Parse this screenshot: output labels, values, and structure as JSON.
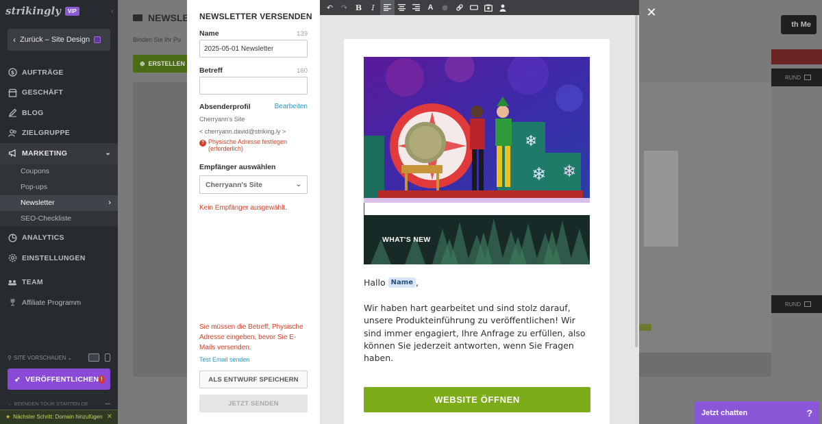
{
  "sidebar": {
    "logo": "strikingly",
    "vip_badge": "VIP",
    "back_button": "Zurück – Site Design",
    "nav": {
      "orders": "AUFTRÄGE",
      "store": "GESCHÄFT",
      "blog": "BLOG",
      "audience": "ZIELGRUPPE",
      "marketing": "MARKETING",
      "sub": [
        "Coupons",
        "Pop-ups",
        "Newsletter",
        "SEO-Checkliste"
      ],
      "analytics": "ANALYTICS",
      "settings": "EINSTELLUNGEN",
      "team": "TEAM",
      "affiliate": "Affiliate Programm"
    },
    "site_preview": "SITE VORSCHAUEN",
    "publish_button": "VERÖFFENTLICHEN",
    "publish_warning": "!",
    "tour_left": "← BEENDEN  TOUR STARTEN  DE",
    "tour_more": "•••",
    "next_step": "Nächster Schritt: Domain hinzufügen"
  },
  "background": {
    "heading": "NEWSLETT",
    "subtitle": "Binden Sie Ihr Pu",
    "create_button": "ERSTELLEN",
    "top_right_button": "th Me",
    "grund_label": "RUND"
  },
  "form": {
    "title": "NEWSLETTER VERSENDEN",
    "name_label": "Name",
    "name_count": "139",
    "name_value": "2025-05-01 Newsletter",
    "subject_label": "Betreff",
    "subject_count": "160",
    "subject_value": "",
    "sender_label": "Absenderprofil",
    "sender_edit": "Bearbeiten",
    "sender_name": "Cherryann's Site",
    "sender_email": "< cherryann.david@striking.ly >",
    "address_warning": "Physische Adresse festlegen (erforderlich)",
    "recipients_label": "Empfänger auswählen",
    "recipients_selected": "Cherryann's Site",
    "no_recipient": "Kein Empfänger ausgewählt.",
    "must_message": "Sie müssen die Betreff, Physische Adresse eingeben, bevor Sie E-Mails versenden.",
    "test_email": "Test Email senden",
    "save_draft": "ALS ENTWURF SPEICHERN",
    "send_now": "JETZT SENDEN"
  },
  "email": {
    "whats_new": "WHAT'S NEW",
    "greeting": "Hallo",
    "name_token": "Name",
    "greeting_punct": ",",
    "body": "Wir haben hart gearbeitet und sind stolz darauf, unsere Produkteinführung zu veröffentlichen! Wir sind immer  engagiert, Ihre Anfrage zu erfüllen, also können Sie jederzeit antworten, wenn Sie Fragen haben.",
    "cta": "WEBSITE ÖFFNEN"
  },
  "chat": {
    "label": "Jetzt chatten",
    "help": "?"
  },
  "colors": {
    "sidebar_bg": "#272a2e",
    "publish": "#8a49d6",
    "cta": "#7cac18",
    "error": "#d0402a",
    "link": "#2a9ac9"
  }
}
